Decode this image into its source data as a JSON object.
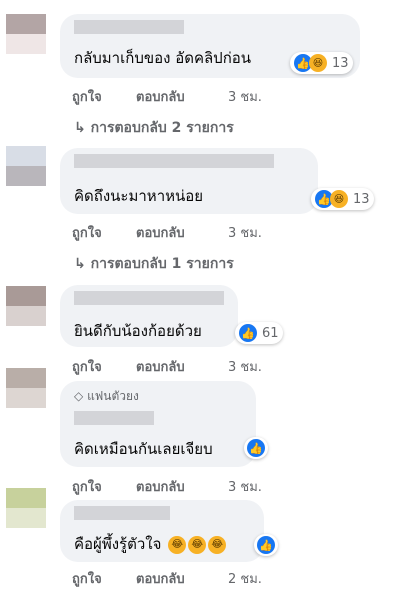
{
  "comments": [
    {
      "text": "กลับมาเก็บของ อัดคลิปก่อน",
      "reaction_count": "13",
      "actions": {
        "like": "ถูกใจ",
        "reply": "ตอบกลับ",
        "time": "3 ชม."
      },
      "replies": "↳  การตอบกลับ 2 รายการ",
      "avatar_colors": [
        "#b3a5a5",
        "#efe6e6"
      ]
    },
    {
      "text": "คิดถึงนะมาหาหน่อย",
      "reaction_count": "13",
      "actions": {
        "like": "ถูกใจ",
        "reply": "ตอบกลับ",
        "time": "3 ชม."
      },
      "replies": "↳  การตอบกลับ 1 รายการ",
      "avatar_colors": [
        "#d8dde6",
        "#b9b6bb"
      ]
    },
    {
      "text": "ยินดีกับน้องก้อยด้วย",
      "reaction_count": "61",
      "actions": {
        "like": "ถูกใจ",
        "reply": "ตอบกลับ",
        "time": "3 ชม."
      },
      "avatar_colors": [
        "#a99a97",
        "#d9d1cf"
      ]
    },
    {
      "badge": "แฟนตัวยง",
      "text": "คิดเหมือนกันเลยเจียบ",
      "actions": {
        "like": "ถูกใจ",
        "reply": "ตอบกลับ",
        "time": "3 ชม."
      },
      "avatar_colors": [
        "#b9aea8",
        "#ddd6d2"
      ]
    },
    {
      "text": "คือผู้พึ้งรู้ตัวใจ",
      "actions": {
        "like": "ถูกใจ",
        "reply": "ตอบกลับ",
        "time": "2 ชม."
      },
      "avatar_colors": [
        "#c7d19c",
        "#e3e7cf"
      ]
    }
  ],
  "icons": {
    "like": "like-thumb-icon",
    "haha": "haha-emoji-icon",
    "badge": "diamond-icon"
  },
  "colors": {
    "bubble": "#f0f2f5",
    "like": "#1877f2",
    "secondary_text": "#65676b"
  }
}
